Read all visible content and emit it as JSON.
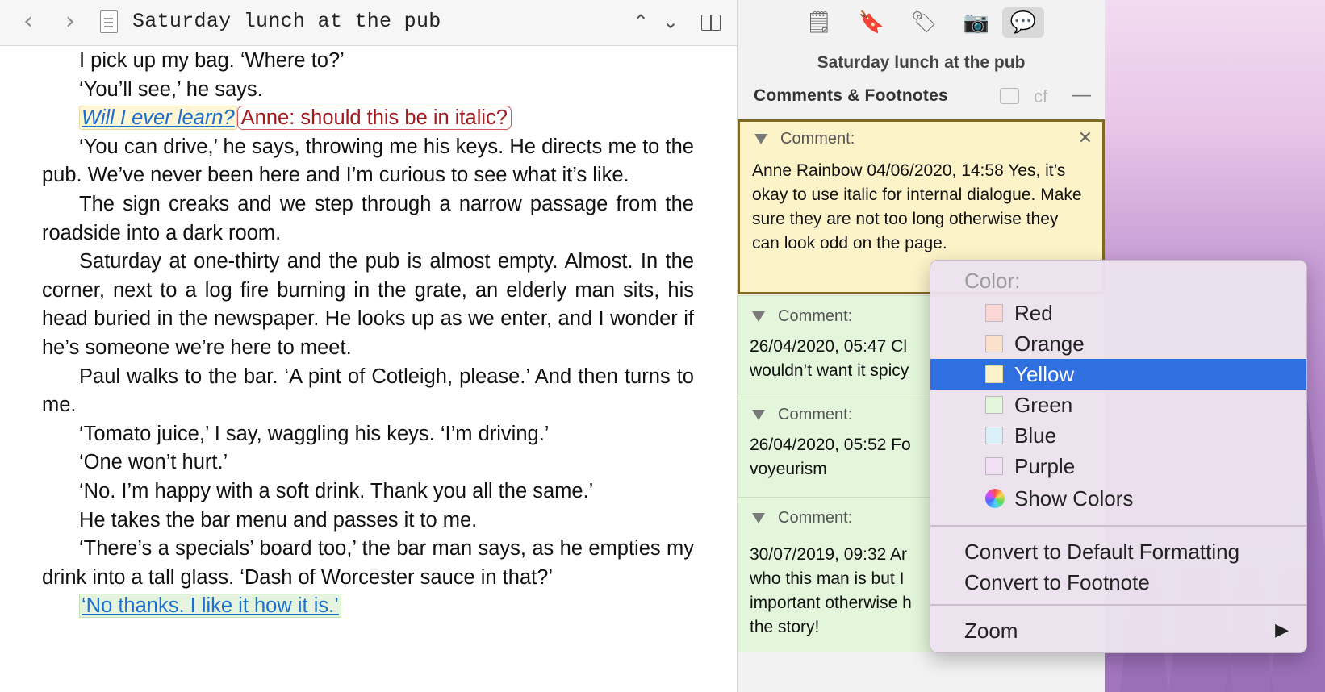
{
  "editor": {
    "title": "Saturday lunch at the pub",
    "nav": {
      "back": "‹",
      "forward": "›",
      "up": "⌃",
      "down": "⌄"
    },
    "paragraphs": [
      {
        "text": "I pick up my bag. ‘Where to?’"
      },
      {
        "text": "‘You’ll see,’ he says."
      },
      {
        "highlight": "Will I ever learn?",
        "inline_comment": "Anne: should this be in italic?"
      },
      {
        "text": "‘You can drive,’ he says, throwing me his keys. He directs me to the pub. We’ve never been here and I’m curious to see what it’s like."
      },
      {
        "text": "The sign creaks and we step through a narrow passage from the roadside into a dark room."
      },
      {
        "text": "Saturday at one-thirty and the pub is almost empty. Almost. In the corner, next to a log fire burning in the grate, an elderly man sits, his head buried in the newspaper. He looks up as we enter, and I wonder if he’s someone we’re here to meet."
      },
      {
        "text": "Paul walks to the bar. ‘A pint of Cotleigh, please.’ And then turns to me."
      },
      {
        "text": "‘Tomato juice,’ I say, waggling his keys. ‘I’m driving.’"
      },
      {
        "text": "‘One won’t hurt.’"
      },
      {
        "text": "‘No. I’m happy with a soft drink. Thank you all the same.’"
      },
      {
        "text": "He takes the bar menu and passes it to me."
      },
      {
        "text": "‘There’s a specials’ board too,’ the bar man says, as he empties my drink into a tall glass. ‘Dash of Worcester sauce in that?’"
      },
      {
        "highlight2": "‘No thanks. I like it how it is.’"
      }
    ]
  },
  "inspector": {
    "doc_title": "Saturday lunch at the pub",
    "section_title": "Comments & Footnotes",
    "cf_label": "cf",
    "comments": [
      {
        "header": "Comment:",
        "body": "Anne Rainbow 04/06/2020, 14:58  Yes, it’s okay to use italic for internal dialogue. Make sure they are not too long otherwise they can look odd on the page."
      },
      {
        "header": "Comment:",
        "body": "26/04/2020, 05:47 Cl wouldn’t want it spicy"
      },
      {
        "header": "Comment:",
        "body": "26/04/2020, 05:52 Fo voyeurism"
      },
      {
        "header": "Comment:",
        "body": "30/07/2019, 09:32 Ar who this man is but I important otherwise h the story!"
      }
    ]
  },
  "context_menu": {
    "color_header": "Color:",
    "colors": [
      {
        "label": "Red",
        "swatch": "#fbd6d6"
      },
      {
        "label": "Orange",
        "swatch": "#fbe0cc"
      },
      {
        "label": "Yellow",
        "swatch": "#fdf3c9"
      },
      {
        "label": "Green",
        "swatch": "#e3f5da"
      },
      {
        "label": "Blue",
        "swatch": "#dcf0fa"
      },
      {
        "label": "Purple",
        "swatch": "#f2e0f5"
      }
    ],
    "show_colors": "Show Colors",
    "convert_default": "Convert to Default Formatting",
    "convert_footnote": "Convert to Footnote",
    "zoom": "Zoom",
    "selected": "Yellow"
  },
  "colors": {
    "accent": "#2f6fe0",
    "comment_yellow": "#fdf3c9",
    "comment_green": "#e3f5da",
    "inline_comment": "#a4191e"
  }
}
